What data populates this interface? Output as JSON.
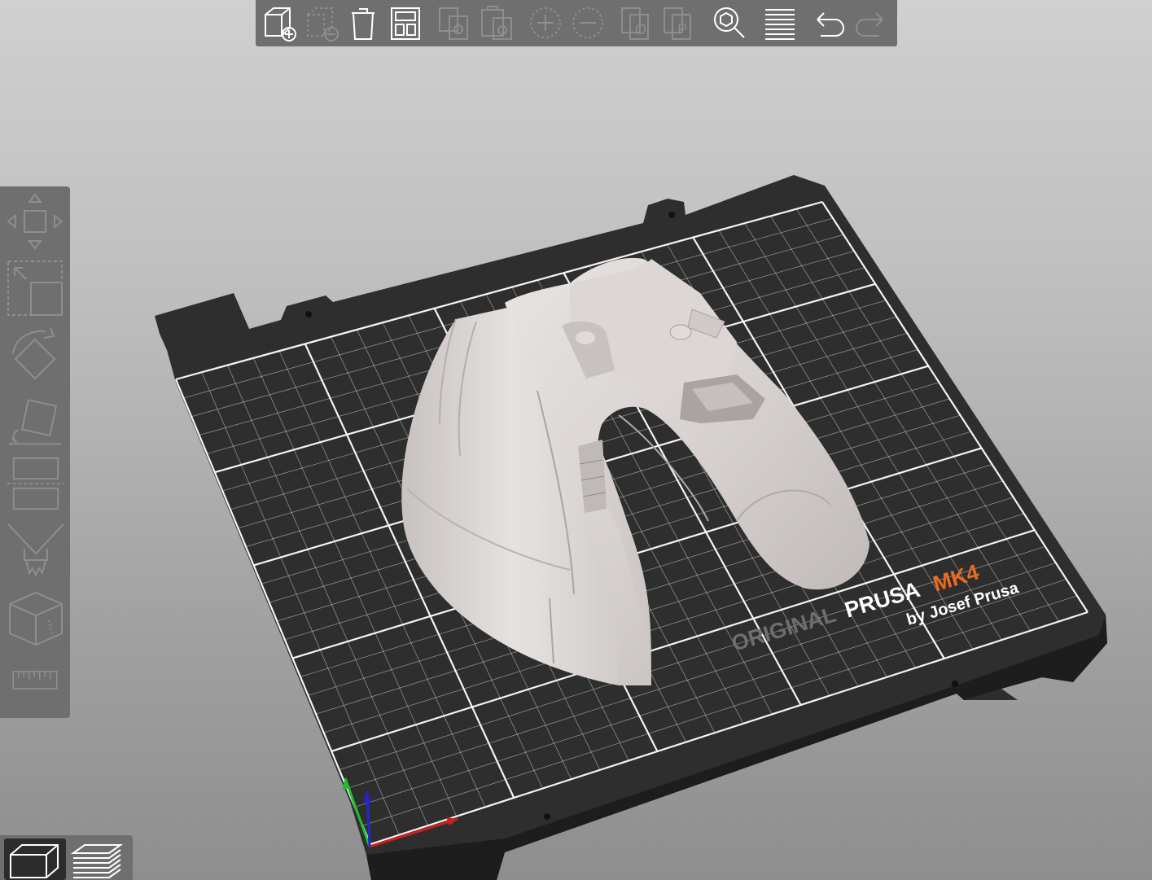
{
  "toolbar": {
    "items": [
      {
        "name": "add-object",
        "icon": "cube-plus-icon",
        "enabled": true
      },
      {
        "name": "delete",
        "icon": "cube-minus-icon",
        "enabled": false
      },
      {
        "name": "delete-all",
        "icon": "trash-icon",
        "enabled": true
      },
      {
        "name": "arrange",
        "icon": "arrange-icon",
        "enabled": true
      },
      {
        "name": "copy",
        "icon": "copy-icon",
        "enabled": false
      },
      {
        "name": "paste",
        "icon": "paste-icon",
        "enabled": false
      },
      {
        "name": "add-instance",
        "icon": "plus-circle-icon",
        "enabled": false
      },
      {
        "name": "remove-instance",
        "icon": "minus-circle-icon",
        "enabled": false
      },
      {
        "name": "split-to-objects",
        "icon": "split-objects-icon",
        "enabled": false
      },
      {
        "name": "split-to-parts",
        "icon": "split-parts-icon",
        "enabled": false
      },
      {
        "name": "search",
        "icon": "search-icon",
        "enabled": true
      },
      {
        "name": "layers-editing",
        "icon": "layers-icon",
        "enabled": true
      },
      {
        "name": "undo",
        "icon": "undo-icon",
        "enabled": true
      },
      {
        "name": "redo",
        "icon": "redo-icon",
        "enabled": false
      }
    ]
  },
  "left_tools": [
    {
      "name": "move",
      "icon": "move-icon"
    },
    {
      "name": "scale",
      "icon": "scale-icon"
    },
    {
      "name": "rotate",
      "icon": "rotate-icon"
    },
    {
      "name": "place-on-face",
      "icon": "place-on-face-icon"
    },
    {
      "name": "cut",
      "icon": "cut-icon"
    },
    {
      "name": "paint-supports",
      "icon": "paint-supports-icon"
    },
    {
      "name": "seam",
      "icon": "seam-cube-icon"
    },
    {
      "name": "measure",
      "icon": "ruler-icon"
    }
  ],
  "view_toggle": {
    "items": [
      {
        "name": "3d-view",
        "icon": "cube-view-icon",
        "active": true
      },
      {
        "name": "preview",
        "icon": "layers-preview-icon",
        "active": false
      }
    ]
  },
  "bed": {
    "brand_original": "ORIGINAL",
    "brand_prusa": "PRUSA",
    "brand_model": "MK4",
    "brand_byline": "by Josef Prusa"
  },
  "colors": {
    "toolbar_bg": "#6f6f6f",
    "icon_enabled": "#ffffff",
    "icon_disabled": "#8e8e8e",
    "bed": "#2e2e2e",
    "grid": "#ffffff",
    "model": "#d4cfcd",
    "brand_orange": "#ec6a1f",
    "axis_x": "#d41d1d",
    "axis_y": "#1cbf2c",
    "axis_z": "#2424d4"
  }
}
